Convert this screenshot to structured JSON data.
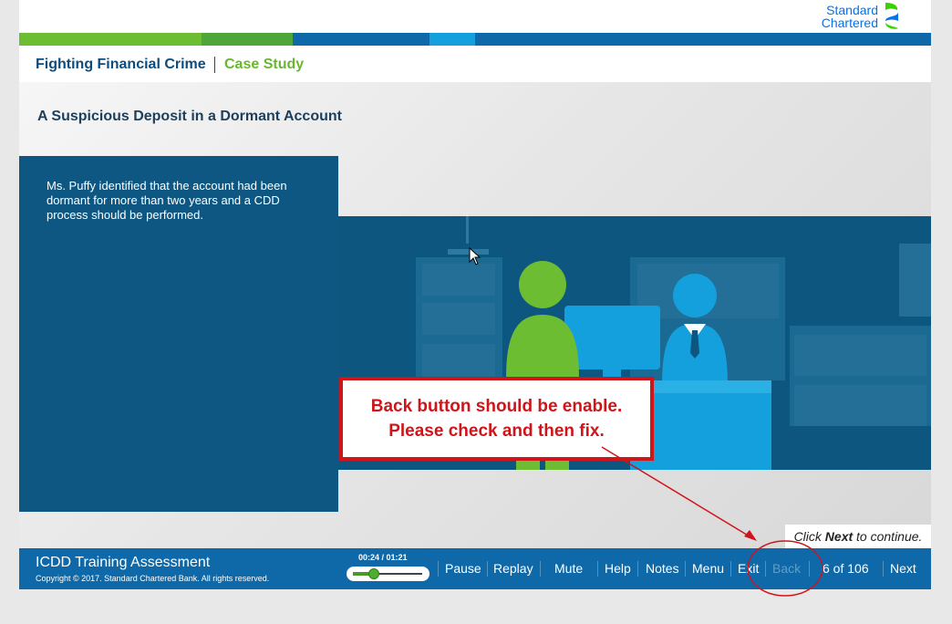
{
  "brand": {
    "line1": "Standard",
    "line2": "Chartered",
    "logo_icon": "sc-logo-icon"
  },
  "colors": {
    "green": "#69b72f",
    "dark_blue": "#0d5782",
    "nav_blue": "#0f69a8",
    "light_blue": "#0d9bd8",
    "red": "#d0141a"
  },
  "header": {
    "course": "Fighting Financial Crime",
    "section": "Case Study"
  },
  "slide": {
    "title": "A Suspicious Deposit in a Dormant Account",
    "text": "Ms. Puffy identified that the account had been dormant for more than two years and a CDD process should be performed.",
    "prompt_pre": "Click ",
    "prompt_bold": "Next",
    "prompt_post": " to continue."
  },
  "callout": {
    "line1": "Back button should be enable.",
    "line2": "Please check and then fix."
  },
  "footer": {
    "title": "ICDD Training Assessment",
    "copyright": "Copyright © 2017. Standard Chartered Bank. All rights reserved.",
    "time": "00:24 / 01:21",
    "progress": 0.3,
    "nav": {
      "pause": "Pause",
      "replay": "Replay",
      "mute": "Mute",
      "help": "Help",
      "notes": "Notes",
      "menu": "Menu",
      "exit": "Exit",
      "back": "Back",
      "page": "6 of 106",
      "next": "Next"
    }
  }
}
